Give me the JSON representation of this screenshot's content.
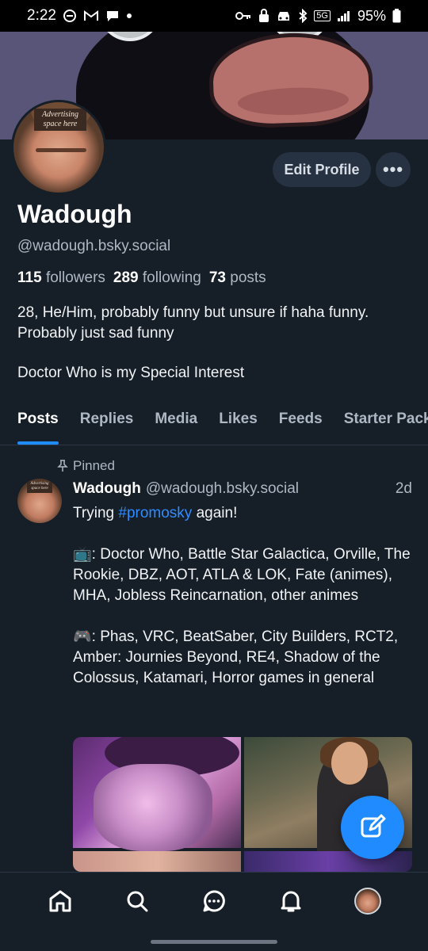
{
  "status_bar": {
    "time": "2:22",
    "network": "5G",
    "battery": "95%"
  },
  "profile": {
    "avatar_sign": "Advertising space here",
    "edit_label": "Edit Profile",
    "more_label": "•••",
    "display_name": "Wadough",
    "handle": "@wadough.bsky.social",
    "followers_count": "115",
    "followers_label": "followers",
    "following_count": "289",
    "following_label": "following",
    "posts_count": "73",
    "posts_label": "posts",
    "bio_line1": "28, He/Him, probably funny but unsure if haha funny. Probably just sad funny",
    "bio_line2": "Doctor Who is my Special Interest"
  },
  "tabs": [
    "Posts",
    "Replies",
    "Media",
    "Likes",
    "Feeds",
    "Starter Packs"
  ],
  "active_tab": "Posts",
  "post": {
    "pinned_label": "Pinned",
    "author": "Wadough",
    "handle": "@wadough.bsky.social",
    "time": "2d",
    "text_pre": "Trying ",
    "hashtag": "#promosky",
    "text_post": " again!",
    "tv_emoji": "📺",
    "tv_text": ": Doctor Who, Battle Star Galactica, Orville, The Rookie, DBZ, AOT, ATLA & LOK, Fate (animes), MHA, Jobless Reincarnation, other animes",
    "game_emoji": "🎮",
    "game_text": ": Phas, VRC, BeatSaber, City Builders, RCT2, Amber: Journies Beyond, RE4, Shadow of the Colossus, Katamari, Horror games in general"
  },
  "bottom_nav": [
    "home-icon",
    "search-icon",
    "chat-icon",
    "bell-icon",
    "profile-avatar"
  ],
  "colors": {
    "background": "#161e27",
    "accent": "#1f8bfe",
    "muted_text": "#aeb8c4",
    "button_bg": "#263242"
  }
}
